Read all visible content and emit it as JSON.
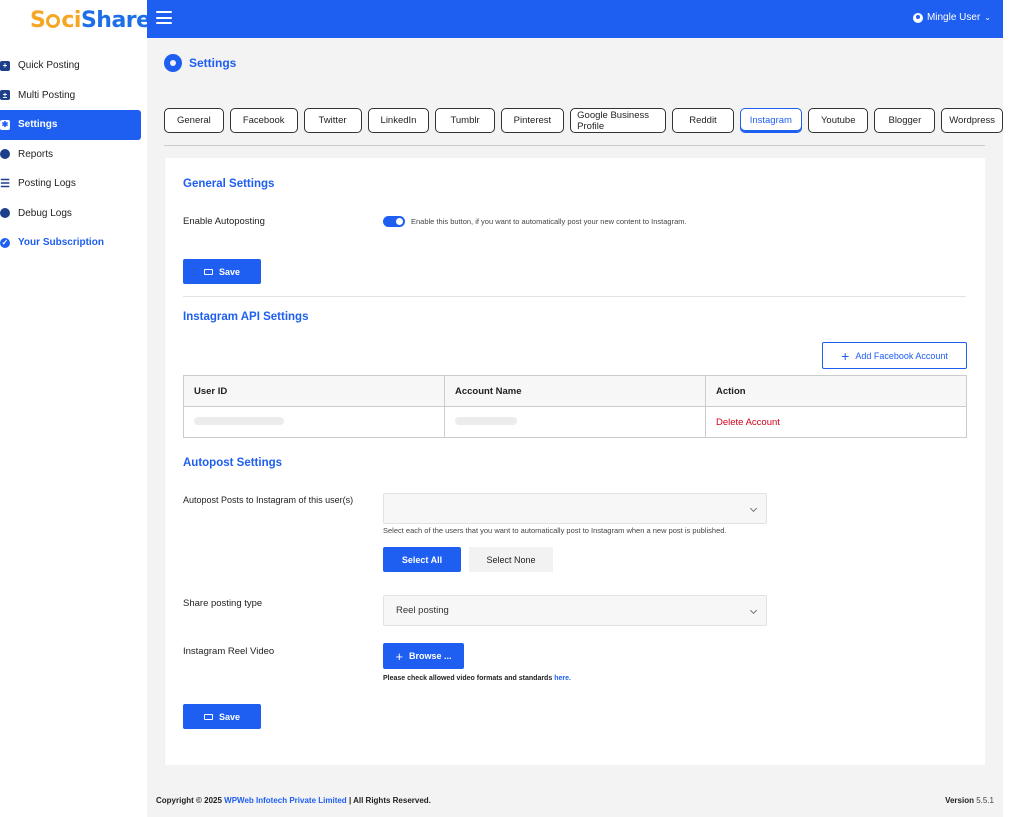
{
  "brand": {
    "logo_text_a": "S",
    "logo_text_b": "ci",
    "logo_text_c": "Share"
  },
  "header": {
    "user_name": "Mingle User"
  },
  "sidebar": {
    "items": [
      {
        "label": "Quick Posting",
        "icon": "plus-square-icon"
      },
      {
        "label": "Multi Posting",
        "icon": "plus-minus-icon"
      },
      {
        "label": "Settings",
        "icon": "gear-icon",
        "active": true
      },
      {
        "label": "Reports",
        "icon": "pie-chart-icon"
      },
      {
        "label": "Posting Logs",
        "icon": "list-icon"
      },
      {
        "label": "Debug Logs",
        "icon": "bug-icon"
      },
      {
        "label": "Your Subscription",
        "icon": "check-circle-icon"
      }
    ]
  },
  "page": {
    "title": "Settings"
  },
  "tabs": [
    "General",
    "Facebook",
    "Twitter",
    "LinkedIn",
    "Tumblr",
    "Pinterest",
    "Google Business Profile",
    "Reddit",
    "Instagram",
    "Youtube",
    "Blogger",
    "Wordpress"
  ],
  "active_tab": "Instagram",
  "general": {
    "heading": "General Settings",
    "autopost_label": "Enable Autoposting",
    "autopost_enabled": true,
    "autopost_hint": "Enable this button, if you want to automatically post your new content to Instagram.",
    "save_label": "Save"
  },
  "api": {
    "heading": "Instagram API Settings",
    "add_account_label": "Add Facebook Account",
    "columns": [
      "User ID",
      "Account Name",
      "Action"
    ],
    "rows": [
      {
        "user_id": "",
        "account_name": "",
        "action": "Delete Account"
      }
    ]
  },
  "autopost": {
    "heading": "Autopost Settings",
    "users_label": "Autopost Posts to Instagram of this user(s)",
    "users_value": "",
    "users_hint": "Select each of the users that you want to automatically post to Instagram when a new post is published.",
    "select_all": "Select All",
    "select_none": "Select None",
    "type_label": "Share posting type",
    "type_value": "Reel posting",
    "video_label": "Instagram Reel Video",
    "browse_label": "Browse ...",
    "formats_note": "Please check allowed video formats and standards",
    "formats_link": "here.",
    "save_label": "Save"
  },
  "footer": {
    "copyright_prefix": "Copyright © 2025",
    "company": "WPWeb Infotech Private Limited",
    "rights": "| All Rights Reserved.",
    "version_label": "Version",
    "version_value": "5.5.1"
  },
  "colors": {
    "accent": "#1e5ef0",
    "danger": "#d0021b",
    "logo_orange": "#f5a623"
  }
}
